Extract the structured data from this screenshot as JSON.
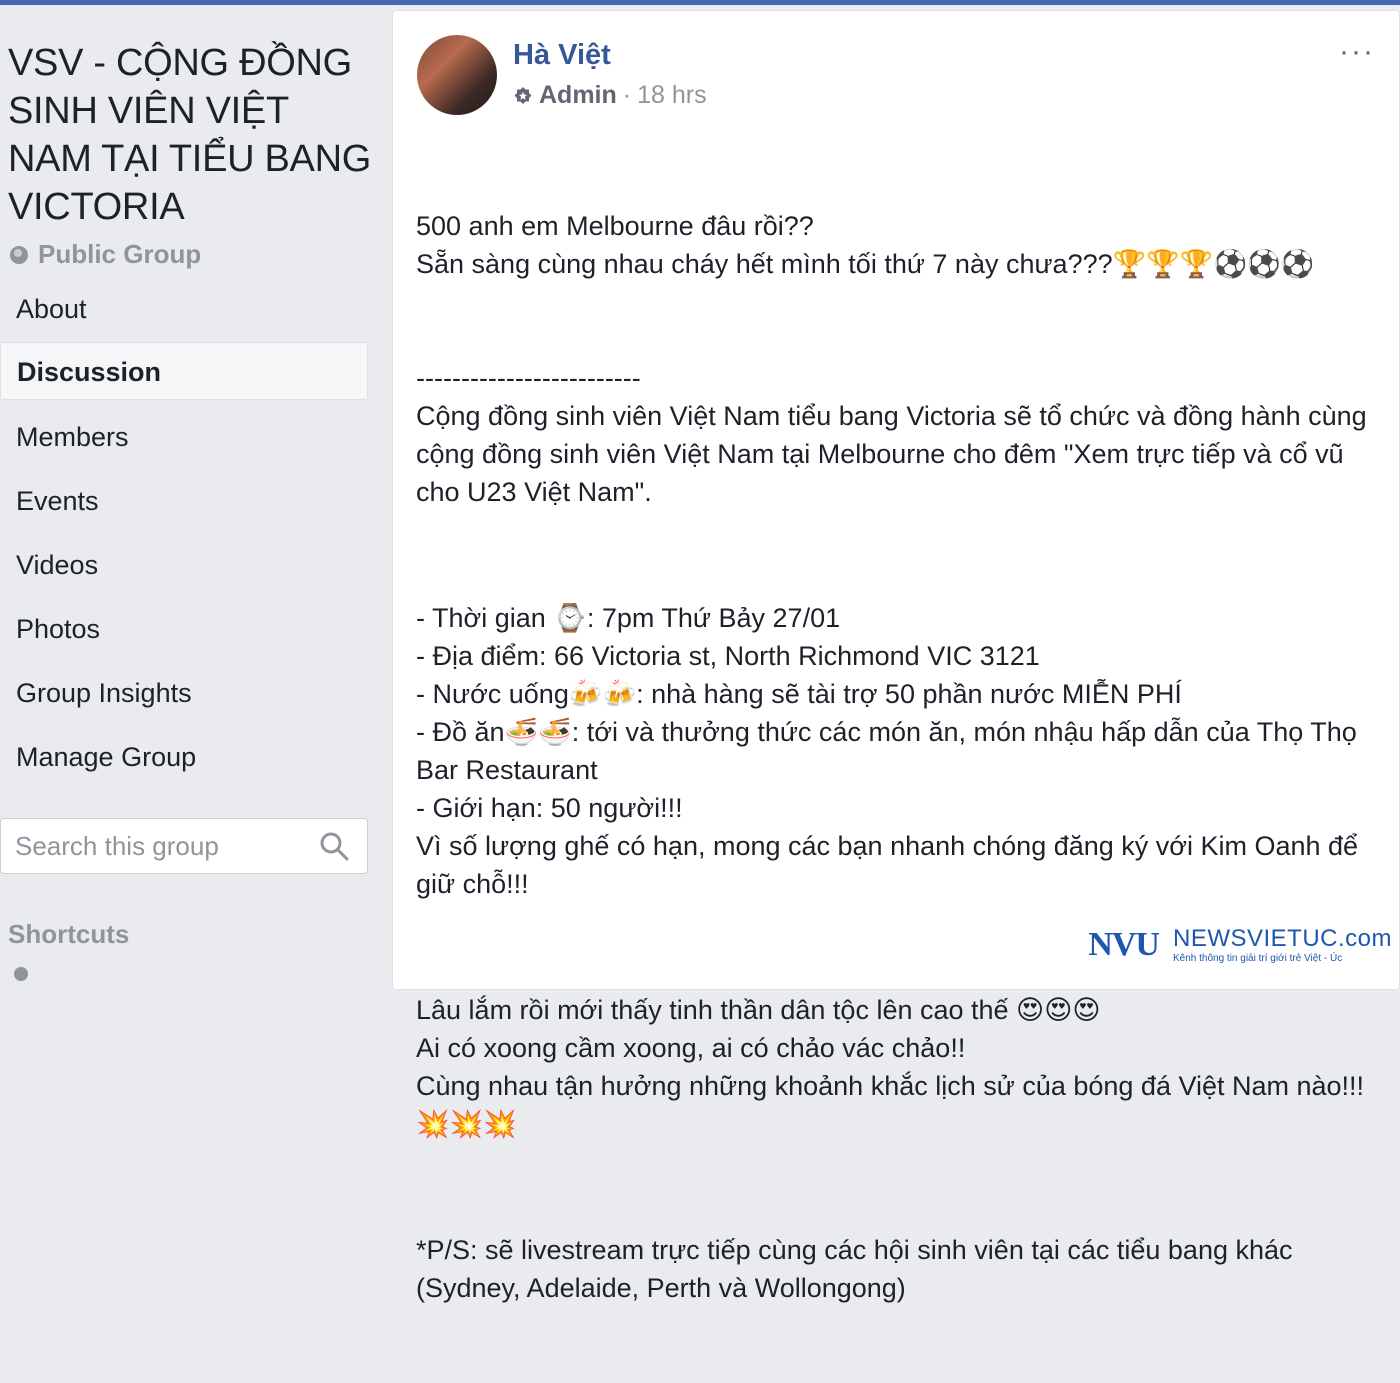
{
  "sidebar": {
    "group_title": "VSV - CỘNG ĐỒNG SINH VIÊN VIỆT NAM TẠI TIỂU BANG VICTORIA",
    "privacy": "Public Group",
    "nav": [
      {
        "label": "About"
      },
      {
        "label": "Discussion",
        "active": true
      },
      {
        "label": "Members"
      },
      {
        "label": "Events"
      },
      {
        "label": "Videos"
      },
      {
        "label": "Photos"
      },
      {
        "label": "Group Insights"
      },
      {
        "label": "Manage Group"
      }
    ],
    "search": {
      "placeholder": "Search this group"
    },
    "shortcuts_heading": "Shortcuts"
  },
  "post": {
    "author": "Hà Việt",
    "role": "Admin",
    "time": "18 hrs",
    "more": "···",
    "paragraphs": [
      "500 anh em Melbourne đâu rồi??\nSẵn sàng cùng nhau cháy hết mình tối thứ 7 này chưa???🏆🏆🏆⚽⚽⚽\n\n\n-------------------------\nCộng đồng sinh viên Việt Nam tiểu bang Victoria sẽ tổ chức và đồng hành cùng cộng đồng sinh viên Việt Nam tại Melbourne cho đêm \"Xem trực tiếp và cổ vũ cho U23 Việt Nam\".",
      "- Thời gian ⌚: 7pm Thứ Bảy 27/01\n- Địa điểm: 66 Victoria st, North Richmond VIC 3121\n- Nước uống🍻🍻: nhà hàng sẽ tài trợ 50 phần nước MIỄN PHÍ\n- Đồ ăn🍜🍜: tới và thưởng thức các món ăn, món nhậu hấp dẫn của Thọ Thọ Bar Restaurant\n- Giới hạn: 50 người!!!\nVì số lượng ghế có hạn, mong các bạn nhanh chóng đăng ký với Kim Oanh để giữ chỗ!!!",
      "Lâu lắm rồi mới thấy tinh thần dân tộc lên cao thế 😍😍😍\nAi có xoong cầm xoong, ai có chảo vác chảo!!\nCùng nhau tận hưởng những khoảnh khắc lịch sử của bóng đá Việt Nam nào!!!💥💥💥",
      "*P/S: sẽ livestream trực tiếp cùng các hội sinh viên tại các tiểu bang khác (Sydney, Adelaide, Perth và Wollongong)"
    ]
  },
  "watermark": {
    "logo": "NVU",
    "title": "NEWSVIETUC.com",
    "subtitle": "Kênh thông tin giải trí giới trẻ Việt - Úc"
  },
  "colors": {
    "accent": "#4267b2",
    "link": "#365899",
    "muted": "#90949c",
    "background": "#e9ebee"
  }
}
